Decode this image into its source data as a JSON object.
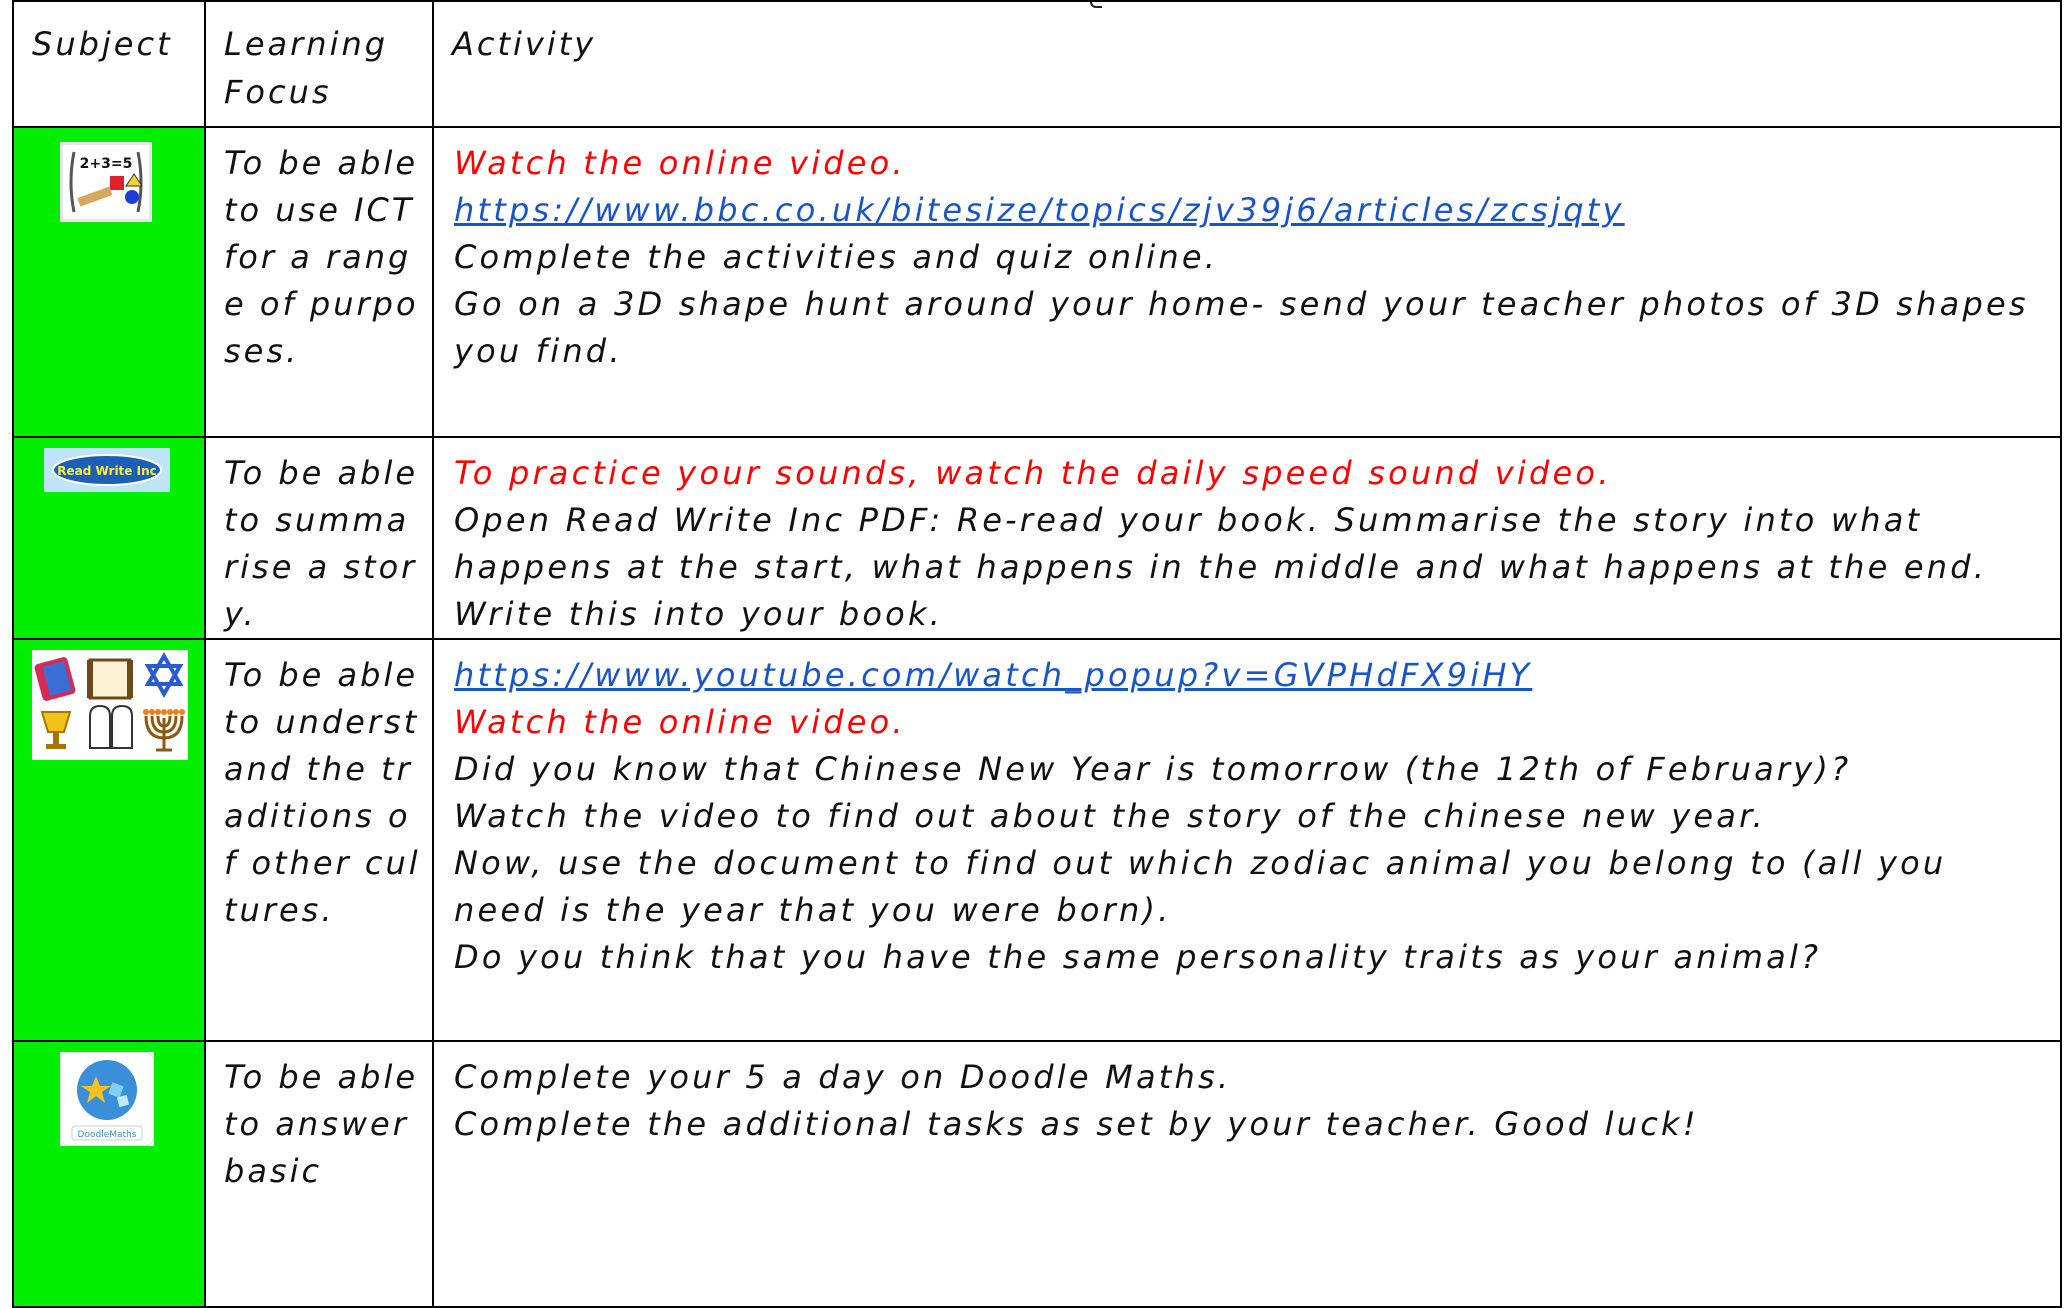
{
  "header": {
    "subject": "Subject",
    "focus_line1": "Learning",
    "focus_line2": "Focus",
    "activity": "Activity"
  },
  "rows": [
    {
      "icon": "maths-shapes-icon",
      "icon_text": "2+3=5",
      "focus": "To be able to use ICT for a range of purposes.",
      "lines": [
        "Watch the online video.",
        "https://www.bbc.co.uk/bitesize/topics/zjv39j6/articles/zcsjqty",
        "Complete the activities and quiz online.",
        "Go on a 3D shape hunt around your home- send your teacher photos of 3D shapes you find."
      ]
    },
    {
      "icon": "read-write-inc-icon",
      "icon_text": "Read Write Inc",
      "focus": "To be able to summarise a story.",
      "lines": [
        "To practice your sounds, watch the daily speed sound video.",
        "Open Read Write Inc PDF: Re-read your book. Summarise the story into what happens at the start, what happens in the middle and what happens at the end. Write this into your book."
      ]
    },
    {
      "icon": "world-faiths-icon",
      "focus": "To be able to understand the traditions of other cultures.",
      "lines": [
        "https://www.youtube.com/watch_popup?v=GVPHdFX9iHY",
        "Watch the online video.",
        "Did you know that Chinese New Year is tomorrow (the 12th of February)?",
        "Watch the video to find out about the story of the chinese new year.",
        "Now, use the document to find out which zodiac animal you belong to (all you need is the year that you were born).",
        "Do you think that you have the same personality traits as your animal?"
      ]
    },
    {
      "icon": "doodle-maths-icon",
      "icon_text": "DoodleMaths",
      "focus": "To be able to answer basic",
      "lines": [
        "Complete your 5 a day on Doodle Maths.",
        "Complete the additional tasks as set by your teacher. Good luck!"
      ]
    }
  ],
  "colors": {
    "subject_cell": "#00ee00",
    "instruction": "#ff0000",
    "link": "#1a55c8"
  }
}
